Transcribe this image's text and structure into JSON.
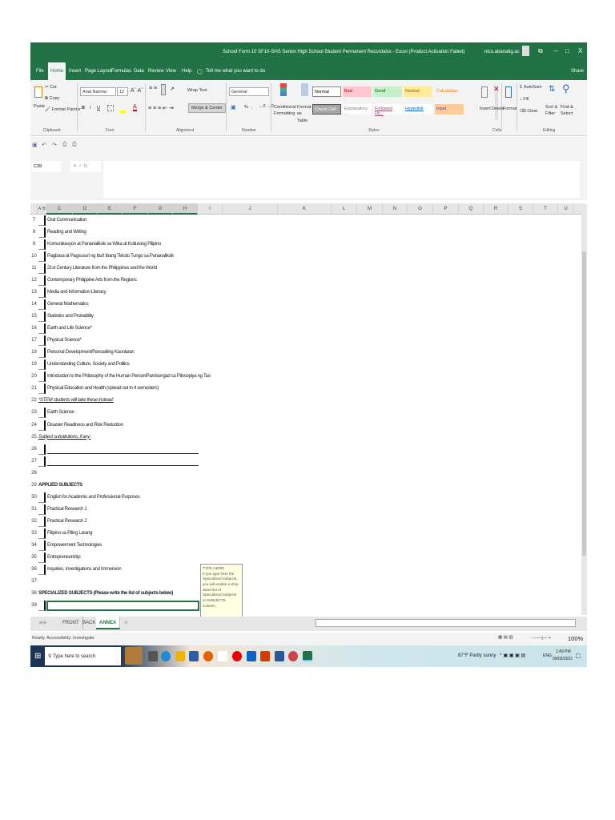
{
  "window": {
    "title": "School Form 10 SF10-SHS Senior High School Student Permanent Recordalsx  -  Excel (Product Activation Failed)",
    "user": "nico.abanatig.ac",
    "controls": [
      "⧉",
      "–",
      "□",
      "X"
    ]
  },
  "ribbon_tabs": [
    "File",
    "Home",
    "Insert",
    "Page Layout",
    "Formulas",
    "Data",
    "Review",
    "View",
    "Help"
  ],
  "tell_me": "Tell me what you want to do",
  "share": "Share",
  "clipboard": {
    "paste": "Paste",
    "cut": "Cut",
    "copy": "Copy",
    "format_painter": "Format Painter",
    "label": "Clipboard"
  },
  "font": {
    "name": "Arial Narrow",
    "size": "12",
    "bold": "B",
    "italic": "I",
    "underline": "U",
    "label": "Font"
  },
  "alignment": {
    "wrap": "Wrap Text",
    "merge": "Merge & Center",
    "label": "Alignment"
  },
  "number": {
    "format": "General",
    "percent": "%",
    "comma": ",",
    "label": "Number"
  },
  "styles": {
    "conditional": "Conditional Formatting",
    "format_as_table": "Format as Table",
    "items": [
      {
        "label": "Normal",
        "bg": "#ffffff",
        "fg": "#000000"
      },
      {
        "label": "Bad",
        "bg": "#ffc7ce",
        "fg": "#9c0006"
      },
      {
        "label": "Good",
        "bg": "#c6efce",
        "fg": "#006100"
      },
      {
        "label": "Neutral",
        "bg": "#ffeb9c",
        "fg": "#9c5700"
      },
      {
        "label": "Calculation",
        "bg": "#f2f2f2",
        "fg": "#fa7d00"
      },
      {
        "label": "Check Cell",
        "bg": "#a5a5a5",
        "fg": "#ffffff"
      },
      {
        "label": "Explanatory ...",
        "bg": "#ffffff",
        "fg": "#7f7f7f"
      },
      {
        "label": "Followed Hy...",
        "bg": "#ffffff",
        "fg": "#954f72"
      },
      {
        "label": "Hyperlink",
        "bg": "#ffffff",
        "fg": "#0563c1"
      },
      {
        "label": "Input",
        "bg": "#ffcc99",
        "fg": "#3f3f76"
      }
    ],
    "label": "Styles"
  },
  "cells": {
    "insert": "Insert",
    "delete": "Delete",
    "format": "Format",
    "label": "Cells"
  },
  "editing": {
    "autosum": "AutoSum",
    "fill": "Fill",
    "clear": "Clear",
    "sort": "Sort & Filter",
    "find": "Find & Select",
    "label": "Editing"
  },
  "name_box": "C39",
  "fx": "fx",
  "columns": [
    "A",
    "B",
    "C",
    "D",
    "E",
    "F",
    "G",
    "H",
    "I",
    "J",
    "K",
    "L",
    "M",
    "N",
    "O",
    "P",
    "Q",
    "R",
    "S",
    "T",
    "U"
  ],
  "rows": [
    {
      "n": "7",
      "text": "Oral Communication",
      "type": "item"
    },
    {
      "n": "8",
      "text": "Reading and Writing",
      "type": "item"
    },
    {
      "n": "9",
      "text": "Komunikasyon at Pananaliksik sa Wika at Kulturang Pilipino",
      "type": "item"
    },
    {
      "n": "10",
      "text": "Pagbasa at Pagsusuri ng Iba't Ibang Teksto Tungo sa Pananaliksik",
      "type": "item"
    },
    {
      "n": "11",
      "text": "21st Century Literature from the Philippines and the World",
      "type": "item"
    },
    {
      "n": "12",
      "text": "Contemporary Philippine Arts from the Regions",
      "type": "item"
    },
    {
      "n": "13",
      "text": "Media and Information Literacy",
      "type": "item"
    },
    {
      "n": "14",
      "text": "General Mathematics",
      "type": "item"
    },
    {
      "n": "15",
      "text": "Statistics and Probability",
      "type": "item"
    },
    {
      "n": "16",
      "text": "Earth and Life Science*",
      "type": "item"
    },
    {
      "n": "17",
      "text": "Physical Science*",
      "type": "item"
    },
    {
      "n": "18",
      "text": "Personal Development/Pansariling Kaunlaran",
      "type": "item"
    },
    {
      "n": "19",
      "text": "Understanding Culture, Society and Politics",
      "type": "item"
    },
    {
      "n": "20",
      "text": "Introduction to the Philosophy of the Human Person/Pambungad sa Pilosopiya ng Tao",
      "type": "item"
    },
    {
      "n": "21",
      "text": "Physical Education and Health (spread out in 4 semesters)",
      "type": "item"
    },
    {
      "n": "22",
      "text": "*STEM students will take these instead:",
      "type": "note"
    },
    {
      "n": "23",
      "text": "Earth Science",
      "type": "item"
    },
    {
      "n": "24",
      "text": "Disaster Readiness and Risk Reduction",
      "type": "item"
    },
    {
      "n": "25",
      "text": "Subject substitutions, if any:",
      "type": "note"
    },
    {
      "n": "26",
      "text": "",
      "type": "line"
    },
    {
      "n": "27",
      "text": "",
      "type": "line"
    },
    {
      "n": "28",
      "text": "",
      "type": "blank"
    },
    {
      "n": "29",
      "text": "APPLIED SUBJECTS",
      "type": "hdr"
    },
    {
      "n": "30",
      "text": "English for Academic and Professional Purposes",
      "type": "item"
    },
    {
      "n": "31",
      "text": "Practical Research 1",
      "type": "item"
    },
    {
      "n": "32",
      "text": "Practical Research 2",
      "type": "item"
    },
    {
      "n": "33",
      "text": "Filipino sa Piling Larang",
      "type": "item"
    },
    {
      "n": "34",
      "text": "Empowerment Technologies",
      "type": "item"
    },
    {
      "n": "35",
      "text": "Entrepreneurship",
      "type": "item"
    },
    {
      "n": "36",
      "text": "Inquiries, Investigations and Immersion",
      "type": "item"
    },
    {
      "n": "37",
      "text": "",
      "type": "blank"
    },
    {
      "n": "38",
      "text": "SPECIALIZED SUBJECTS (Please write the list of subjects below)",
      "type": "hdr"
    },
    {
      "n": "39",
      "text": "",
      "type": "active"
    }
  ],
  "comment": {
    "title": "TYPE HERE!",
    "body": "If you type here the Specialized Subjects, you will enable a drop-down list of Specialized Subjects in SUBJECTS Column."
  },
  "sheet_tabs": [
    "FRONT",
    "BACK",
    "ANNEX"
  ],
  "active_sheet": "ANNEX",
  "status": {
    "ready": "Ready",
    "accessibility": "Accessibility: Investigate",
    "zoom": "100%"
  },
  "taskbar": {
    "search": "Type here to search",
    "weather": "87°F  Partly sunny",
    "lang": "ENG",
    "time": "1:49 PM",
    "date": "09/02/2022"
  }
}
